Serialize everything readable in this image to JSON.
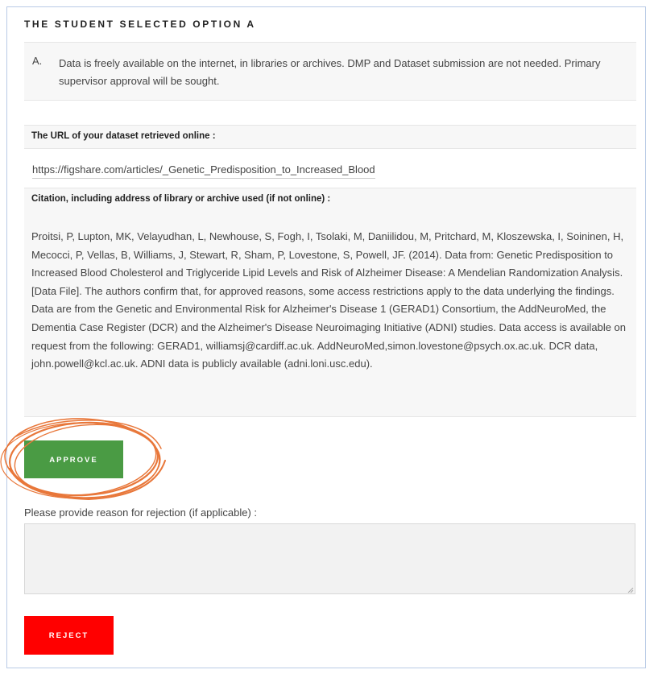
{
  "heading": "THE STUDENT SELECTED OPTION A",
  "option": {
    "letter": "A.",
    "text": "Data is freely available on the internet, in libraries or archives. DMP and Dataset submission are not needed. Primary supervisor approval will be sought."
  },
  "url_field": {
    "label": "The URL of your dataset retrieved online :",
    "value": "https://figshare.com/articles/_Genetic_Predisposition_to_Increased_Blood"
  },
  "citation_field": {
    "label": "Citation, including address of library or archive used (if not online) :",
    "value": "Proitsi, P, Lupton, MK, Velayudhan, L, Newhouse, S, Fogh, I, Tsolaki, M, Daniilidou, M, Pritchard, M, Kloszewska, I, Soininen, H, Mecocci, P, Vellas, B, Williams, J, Stewart, R, Sham, P, Lovestone, S, Powell, JF. (2014). Data from: Genetic Predisposition to Increased Blood Cholesterol and Triglyceride Lipid Levels and Risk of Alzheimer Disease: A Mendelian Randomization Analysis. [Data File]. The authors confirm that, for approved reasons, some access restrictions apply to the data underlying the findings. Data are from the Genetic and Environmental Risk for Alzheimer's Disease 1 (GERAD1) Consortium, the AddNeuroMed, the Dementia Case Register (DCR) and the Alzheimer's Disease Neuroimaging Initiative (ADNI) studies. Data access is available on request from the following: GERAD1, williamsj@cardiff.ac.uk. AddNeuroMed,simon.lovestone@psych.ox.ac.uk. DCR data, john.powell@kcl.ac.uk. ADNI data is publicly available (adni.loni.usc.edu)."
  },
  "approve_label": "APPROVE",
  "rejection": {
    "label": "Please provide reason for rejection (if applicable) :",
    "value": "",
    "button_label": "REJECT"
  },
  "colors": {
    "approve": "#4a9b44",
    "reject": "#ff0000",
    "annotation_circle": "#e8773a"
  }
}
